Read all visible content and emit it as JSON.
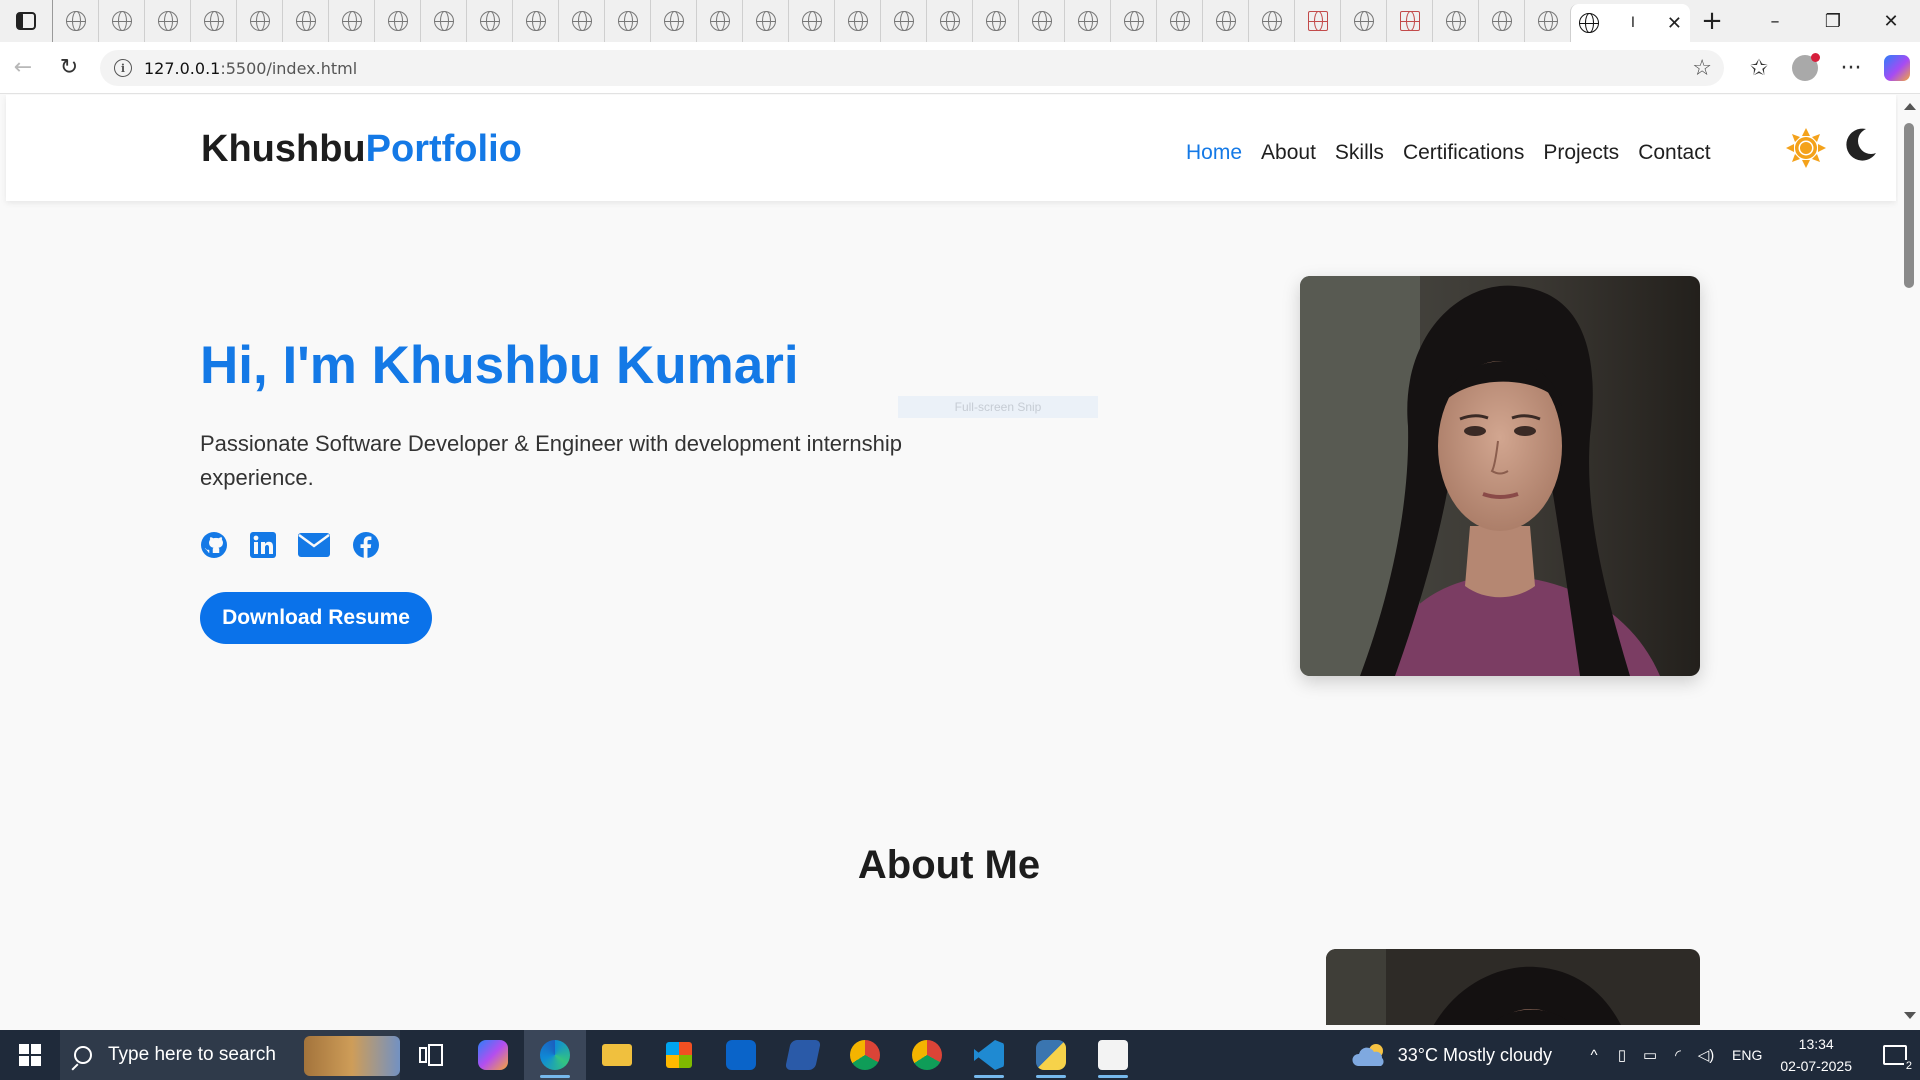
{
  "browser": {
    "url_host": "127.0.0.1",
    "url_path": ":5500/index.html",
    "tab_count_background": 33,
    "active_tab_label": "I",
    "new_tab_label": "+",
    "window_controls": [
      "–",
      "❐",
      "✕"
    ]
  },
  "nav": {
    "logo_main": "Khushbu",
    "logo_accent": "Portfolio",
    "links": [
      {
        "label": "Home",
        "active": true
      },
      {
        "label": "About",
        "active": false
      },
      {
        "label": "Skills",
        "active": false
      },
      {
        "label": "Certifications",
        "active": false
      },
      {
        "label": "Projects",
        "active": false
      },
      {
        "label": "Contact",
        "active": false
      }
    ],
    "theme_icons": [
      "sun-icon",
      "moon-icon"
    ]
  },
  "hero": {
    "title": "Hi, I'm Khushbu Kumari",
    "description": "Passionate Software Developer & Engineer with development internship experience.",
    "socials": [
      "github-icon",
      "linkedin-icon",
      "email-icon",
      "facebook-icon"
    ],
    "resume_button": "Download Resume",
    "snip_overlay": "Full-screen Snip"
  },
  "about": {
    "title": "About Me"
  },
  "taskbar": {
    "search_placeholder": "Type here to search",
    "weather": "33°C  Mostly cloudy",
    "language": "ENG",
    "time": "13:34",
    "date": "02-07-2025",
    "notification_count": "2"
  },
  "colors": {
    "accent": "#1479e6",
    "button": "#0a72ea",
    "sun": "#f4a21b",
    "taskbar": "#1f2a3a"
  }
}
